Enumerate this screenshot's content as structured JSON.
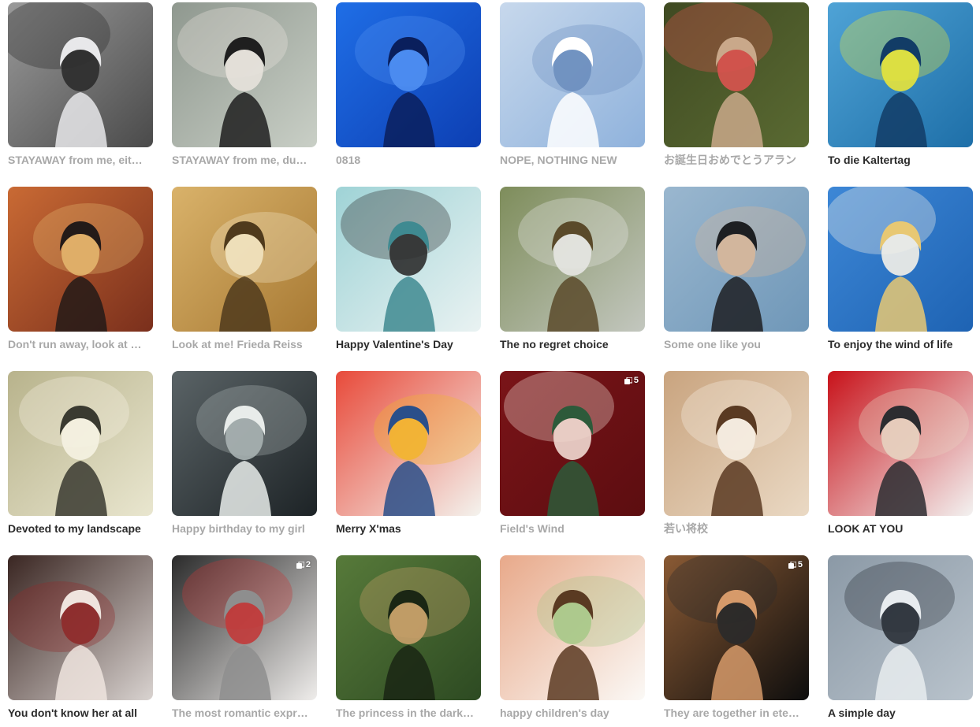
{
  "gallery": {
    "items": [
      {
        "title": "STAYAWAY from me, eit…",
        "muted": true,
        "badge": "",
        "icon": "portrait-thumbnail",
        "colors": [
          "#4a4a4a",
          "#9a9a9a",
          "#e8e8ea",
          "#2c2c2c"
        ]
      },
      {
        "title": "STAYAWAY from me, du…",
        "muted": true,
        "badge": "",
        "icon": "portrait-thumbnail",
        "colors": [
          "#c9cfc6",
          "#8f988f",
          "#1f1f1f",
          "#e7e2dc"
        ]
      },
      {
        "title": "0818",
        "muted": true,
        "badge": "",
        "icon": "portrait-thumbnail",
        "colors": [
          "#0d3fb3",
          "#1f6ee6",
          "#0a1f5c",
          "#4f8ff2"
        ]
      },
      {
        "title": "NOPE, NOTHING NEW",
        "muted": true,
        "badge": "",
        "icon": "portrait-thumbnail",
        "colors": [
          "#8fb2dc",
          "#c7d8ec",
          "#ffffff",
          "#6d8fbf"
        ]
      },
      {
        "title": "お誕生日おめでとうアラン",
        "muted": true,
        "badge": "",
        "icon": "portrait-thumbnail",
        "colors": [
          "#5a6a32",
          "#3f4a22",
          "#c9a88a",
          "#d9534f"
        ]
      },
      {
        "title": "To die Kaltertag",
        "muted": false,
        "badge": "",
        "icon": "portrait-thumbnail",
        "colors": [
          "#1e6fa8",
          "#4fa3d6",
          "#123c66",
          "#e8e43a"
        ]
      },
      {
        "title": "Don't run away, look at …",
        "muted": true,
        "badge": "",
        "icon": "portrait-thumbnail",
        "colors": [
          "#7a2f1c",
          "#c96a34",
          "#231a18",
          "#e3b56d"
        ]
      },
      {
        "title": "Look at me! Frieda Reiss",
        "muted": true,
        "badge": "",
        "icon": "portrait-thumbnail",
        "colors": [
          "#a87a34",
          "#d9b26a",
          "#4f3a1c",
          "#f1e3c0"
        ]
      },
      {
        "title": "Happy Valentine's Day",
        "muted": false,
        "badge": "",
        "icon": "portrait-thumbnail",
        "colors": [
          "#e9f2f2",
          "#9fd3d6",
          "#3f8a91",
          "#2d2d2d"
        ]
      },
      {
        "title": "The no regret choice",
        "muted": false,
        "badge": "",
        "icon": "portrait-thumbnail",
        "colors": [
          "#c3c7bf",
          "#7e8d5b",
          "#5a4a2a",
          "#e6e6e2"
        ]
      },
      {
        "title": "Some one like you",
        "muted": true,
        "badge": "",
        "icon": "portrait-thumbnail",
        "colors": [
          "#6f97b8",
          "#9ab7cf",
          "#1d1f22",
          "#d7b79a"
        ]
      },
      {
        "title": "To enjoy the wind of life",
        "muted": false,
        "badge": "",
        "icon": "portrait-thumbnail",
        "colors": [
          "#1e63b3",
          "#3d87d6",
          "#e8c873",
          "#f4f1e8"
        ]
      },
      {
        "title": "Devoted to my landscape",
        "muted": false,
        "badge": "",
        "icon": "portrait-thumbnail",
        "colors": [
          "#e9e6cf",
          "#b8b38c",
          "#3a3a30",
          "#f5f2e2"
        ]
      },
      {
        "title": "Happy birthday to my girl",
        "muted": true,
        "badge": "",
        "icon": "portrait-thumbnail",
        "colors": [
          "#1d2326",
          "#5a6366",
          "#e8ecea",
          "#a9b3b2"
        ]
      },
      {
        "title": "Merry X'mas",
        "muted": false,
        "badge": "",
        "icon": "portrait-thumbnail",
        "colors": [
          "#f4f3ee",
          "#e84a3a",
          "#2a4f8a",
          "#f2b530"
        ]
      },
      {
        "title": "Field's Wind",
        "muted": true,
        "badge": "5",
        "icon": "portrait-thumbnail",
        "colors": [
          "#5c0d10",
          "#7a1418",
          "#2d5a3a",
          "#f1d9d0"
        ]
      },
      {
        "title": "若い将校",
        "muted": true,
        "badge": "",
        "icon": "portrait-thumbnail",
        "colors": [
          "#ead9c4",
          "#c9a47f",
          "#5a3a22",
          "#f5ede2"
        ]
      },
      {
        "title": "LOOK AT YOU",
        "muted": false,
        "badge": "",
        "icon": "portrait-thumbnail",
        "colors": [
          "#f3f2f1",
          "#c8121a",
          "#2c2c30",
          "#e7d2c0"
        ]
      },
      {
        "title": "You don't know her at all",
        "muted": false,
        "badge": "",
        "icon": "portrait-thumbnail",
        "colors": [
          "#d9d3d0",
          "#3a2622",
          "#efe4de",
          "#8f2a2a"
        ]
      },
      {
        "title": "The most romantic expr…",
        "muted": true,
        "badge": "2",
        "icon": "portrait-thumbnail",
        "colors": [
          "#efedeb",
          "#2b2b2b",
          "#8e8e8e",
          "#c23a3a"
        ]
      },
      {
        "title": "The princess in the dark…",
        "muted": true,
        "badge": "",
        "icon": "portrait-thumbnail",
        "colors": [
          "#2d4a22",
          "#577a3a",
          "#1a2614",
          "#c9a06a"
        ]
      },
      {
        "title": "happy children's day",
        "muted": true,
        "badge": "",
        "icon": "portrait-thumbnail",
        "colors": [
          "#fbf9f6",
          "#e8a98a",
          "#5a3a22",
          "#a9c98a"
        ]
      },
      {
        "title": "They are together in ete…",
        "muted": true,
        "badge": "5",
        "icon": "portrait-thumbnail",
        "colors": [
          "#0d0d0d",
          "#8a5a34",
          "#d69a6a",
          "#2a2a2a"
        ]
      },
      {
        "title": "A simple day",
        "muted": false,
        "badge": "",
        "icon": "portrait-thumbnail",
        "colors": [
          "#b9c3cc",
          "#8b99a6",
          "#e8ecef",
          "#2b3138"
        ]
      }
    ]
  }
}
